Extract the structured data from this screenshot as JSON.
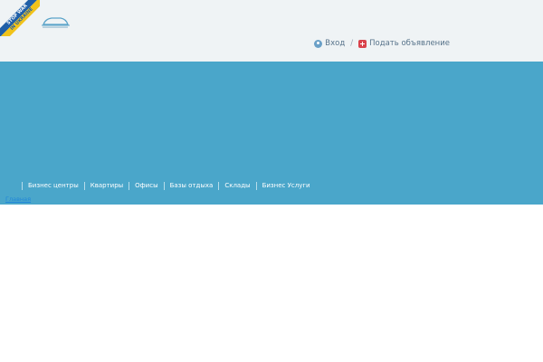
{
  "ribbon": {
    "line1": "STOP WAR",
    "line2": "IN UKRAINE"
  },
  "logo": {
    "icon": "car-logo-icon"
  },
  "auth": {
    "login_label": "Вход",
    "separator": "/",
    "post_ad_label": "Подать объявление"
  },
  "nav": {
    "items": [
      "Бизнес центры",
      "Квартиры",
      "Офисы",
      "Базы отдыха",
      "Склады",
      "Бизнес Услуги"
    ]
  },
  "breadcrumb": {
    "home": "Главная"
  },
  "colors": {
    "header_bg": "#eff3f5",
    "banner_bg": "#4aa6ca",
    "link": "#1f86d9",
    "plus_icon": "#d9424b"
  }
}
